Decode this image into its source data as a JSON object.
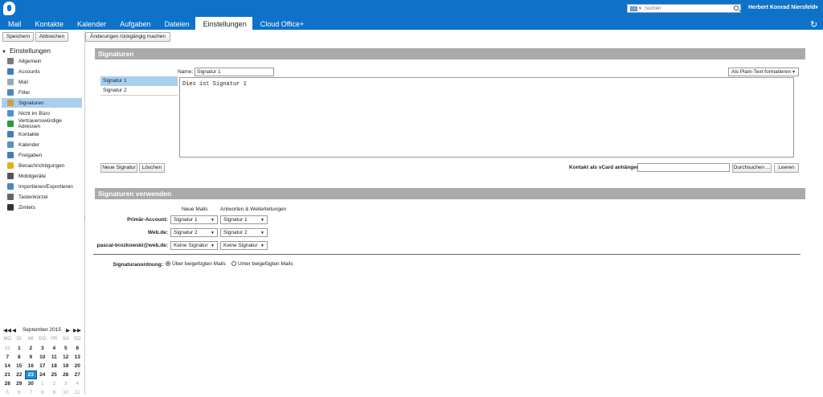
{
  "topbar": {
    "tabs": [
      {
        "label": "Mail"
      },
      {
        "label": "Kontakte"
      },
      {
        "label": "Kalender"
      },
      {
        "label": "Aufgaben"
      },
      {
        "label": "Dateien"
      },
      {
        "label": "Einstellungen",
        "active": true
      },
      {
        "label": "Cloud Office+"
      }
    ],
    "search_placeholder": "Suchen",
    "user_name": "Herbert Konrad Niersfeld"
  },
  "toolbar": {
    "save_label": "Speichern",
    "cancel_label": "Abbrechen",
    "undo_label": "Änderungen rückgängig machen"
  },
  "sidebar": {
    "title": "Einstellungen",
    "items": [
      {
        "label": "Allgemein",
        "icon": "gear-icon",
        "color": "#7a7a7a"
      },
      {
        "label": "Accounts",
        "icon": "accounts-icon",
        "color": "#3f7dbf"
      },
      {
        "label": "Mail",
        "icon": "mail-icon",
        "color": "#9aa8b8"
      },
      {
        "label": "Filter",
        "icon": "filter-icon",
        "color": "#4a86c5"
      },
      {
        "label": "Signaturen",
        "icon": "signature-icon",
        "color": "#c9a14a",
        "active": true
      },
      {
        "label": "Nicht im Büro",
        "icon": "out-of-office-icon",
        "color": "#4e8fd0"
      },
      {
        "label": "Vertrauenswürdige Adressen",
        "icon": "shield-icon",
        "color": "#2e9a3a"
      },
      {
        "label": "Kontakte",
        "icon": "contacts-icon",
        "color": "#3f7dbf"
      },
      {
        "label": "Kalender",
        "icon": "calendar-icon",
        "color": "#5a8fc8"
      },
      {
        "label": "Freigaben",
        "icon": "share-icon",
        "color": "#3f7dbf"
      },
      {
        "label": "Benachrichtigungen",
        "icon": "bell-icon",
        "color": "#e0b020"
      },
      {
        "label": "Mobilgeräte",
        "icon": "mobile-icon",
        "color": "#555"
      },
      {
        "label": "Importieren/Exportieren",
        "icon": "import-export-icon",
        "color": "#4a86c5"
      },
      {
        "label": "Tastenkürzel",
        "icon": "keyboard-icon",
        "color": "#666"
      },
      {
        "label": "Zimlets",
        "icon": "zimlet-icon",
        "color": "#333"
      }
    ]
  },
  "signatures": {
    "section_title": "Signaturen",
    "list": [
      {
        "label": "Signatur 1",
        "active": true
      },
      {
        "label": "Signatur 2"
      }
    ],
    "name_label": "Name:",
    "name_value": "Signatur 1",
    "format_option": "Als Plain-Text formatieren",
    "body_text": "Dies ist Signatur 1",
    "new_label": "Neue Signatur",
    "delete_label": "Löschen",
    "vcard_label": "Kontakt als vCard anhängen:",
    "browse_label": "Durchsuchen ...",
    "clear_label": "Leeren"
  },
  "usage": {
    "section_title": "Signaturen verwenden",
    "col_new": "Neue Mails",
    "col_reply": "Antworten & Weiterleitungen",
    "rows": [
      {
        "label": "Primär-Account:",
        "new": "Signatur 1",
        "reply": "Signatur 1"
      },
      {
        "label": "Web.de:",
        "new": "Signatur 2",
        "reply": "Signatur 2"
      },
      {
        "label": "pascal-brozkowski@web.de:",
        "new": "Keine Signatur",
        "reply": "Keine Signatur"
      }
    ],
    "placement_label": "Signaturanordnung:",
    "option_above": "Über beigefügten Mails",
    "option_below": "Unter beigefügten Mails",
    "selected": "above"
  },
  "calendar": {
    "month_label": "September 2015",
    "weekdays": [
      "MO",
      "DI",
      "MI",
      "DO",
      "FR",
      "SA",
      "SO"
    ],
    "weeks": [
      [
        "31",
        "1",
        "2",
        "3",
        "4",
        "5",
        "6"
      ],
      [
        "7",
        "8",
        "9",
        "10",
        "11",
        "12",
        "13"
      ],
      [
        "14",
        "15",
        "16",
        "17",
        "18",
        "19",
        "20"
      ],
      [
        "21",
        "22",
        "23",
        "24",
        "25",
        "26",
        "27"
      ],
      [
        "28",
        "29",
        "30",
        "1",
        "2",
        "3",
        "4"
      ],
      [
        "5",
        "6",
        "7",
        "8",
        "9",
        "10",
        "11"
      ]
    ],
    "today": "23"
  }
}
